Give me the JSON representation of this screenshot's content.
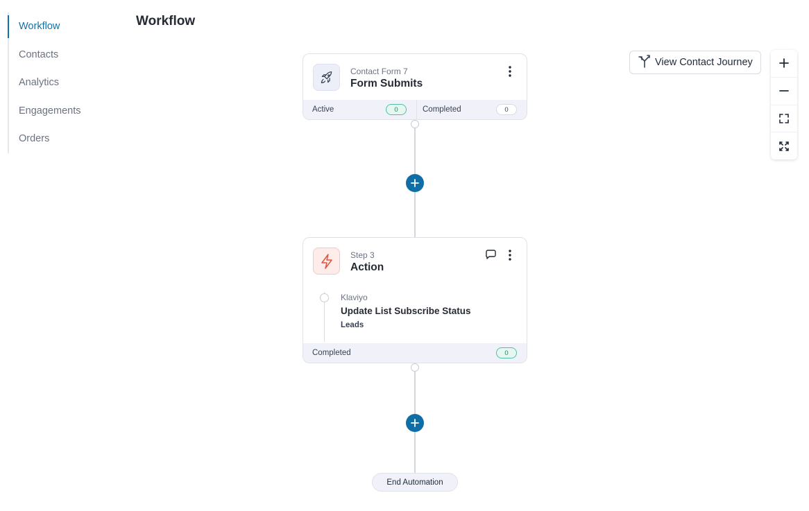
{
  "sidebar": {
    "items": [
      {
        "label": "Workflow",
        "active": true
      },
      {
        "label": "Contacts"
      },
      {
        "label": "Analytics"
      },
      {
        "label": "Engagements"
      },
      {
        "label": "Orders"
      }
    ]
  },
  "page": {
    "title": "Workflow"
  },
  "toolbar": {
    "journey_label": "View Contact Journey",
    "journey_icon": "branch-icon",
    "zoom": [
      "zoom-in-icon",
      "zoom-out-icon",
      "fit-view-icon",
      "fullscreen-icon"
    ]
  },
  "trigger_card": {
    "subtitle": "Contact Form 7",
    "title": "Form Submits",
    "icon": "rocket-icon",
    "stats": [
      {
        "label": "Active",
        "value": "0"
      },
      {
        "label": "Completed",
        "value": "0"
      }
    ]
  },
  "action_card": {
    "subtitle": "Step 3",
    "title": "Action",
    "icon": "lightning-icon",
    "step": {
      "app": "Klaviyo",
      "name": "Update List Subscribe Status",
      "detail": "Leads"
    },
    "stats": [
      {
        "label": "Completed",
        "value": "0"
      }
    ]
  },
  "end": {
    "label": "End Automation"
  },
  "colors": {
    "accent": "#1470a8",
    "add_button": "#0f6ea6",
    "success": "#4fc1a1",
    "action_icon": "#e0533f"
  }
}
